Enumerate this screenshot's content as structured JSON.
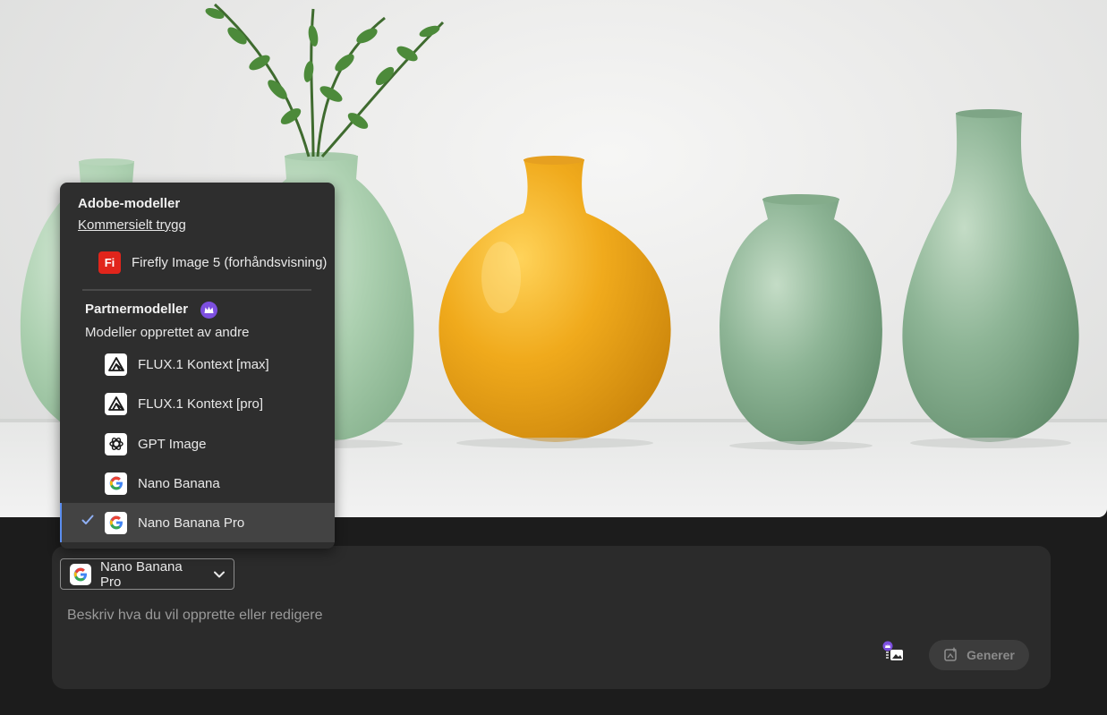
{
  "menu": {
    "adobe_section_title": "Adobe-modeller",
    "adobe_section_link": "Kommersielt trygg",
    "adobe_models": [
      {
        "label": "Firefly Image 5 (forhåndsvisning)",
        "icon": "firefly-icon",
        "icon_text": "Fi"
      }
    ],
    "partner_section_title": "Partnermodeller",
    "partner_section_subtitle": "Modeller opprettet av andre",
    "partner_models": [
      {
        "label": "FLUX.1 Kontext [max]",
        "icon": "flux-icon"
      },
      {
        "label": "FLUX.1 Kontext [pro]",
        "icon": "flux-icon"
      },
      {
        "label": "GPT Image",
        "icon": "openai-icon"
      },
      {
        "label": "Nano Banana",
        "icon": "google-icon"
      },
      {
        "label": "Nano Banana Pro",
        "icon": "google-icon",
        "selected": true
      }
    ]
  },
  "prompt": {
    "selected_model": "Nano Banana Pro",
    "placeholder": "Beskriv hva du vil opprette eller redigere",
    "value": "",
    "generate_label": "Generer"
  },
  "colors": {
    "background": "#1c1c1c",
    "panel": "#2b2b2b",
    "menu": "#2e2e2e",
    "selected_row": "#434343",
    "accent_blue": "#5b8ef0",
    "premium_purple": "#7d4fe0",
    "firefly_red": "#e1251b"
  }
}
